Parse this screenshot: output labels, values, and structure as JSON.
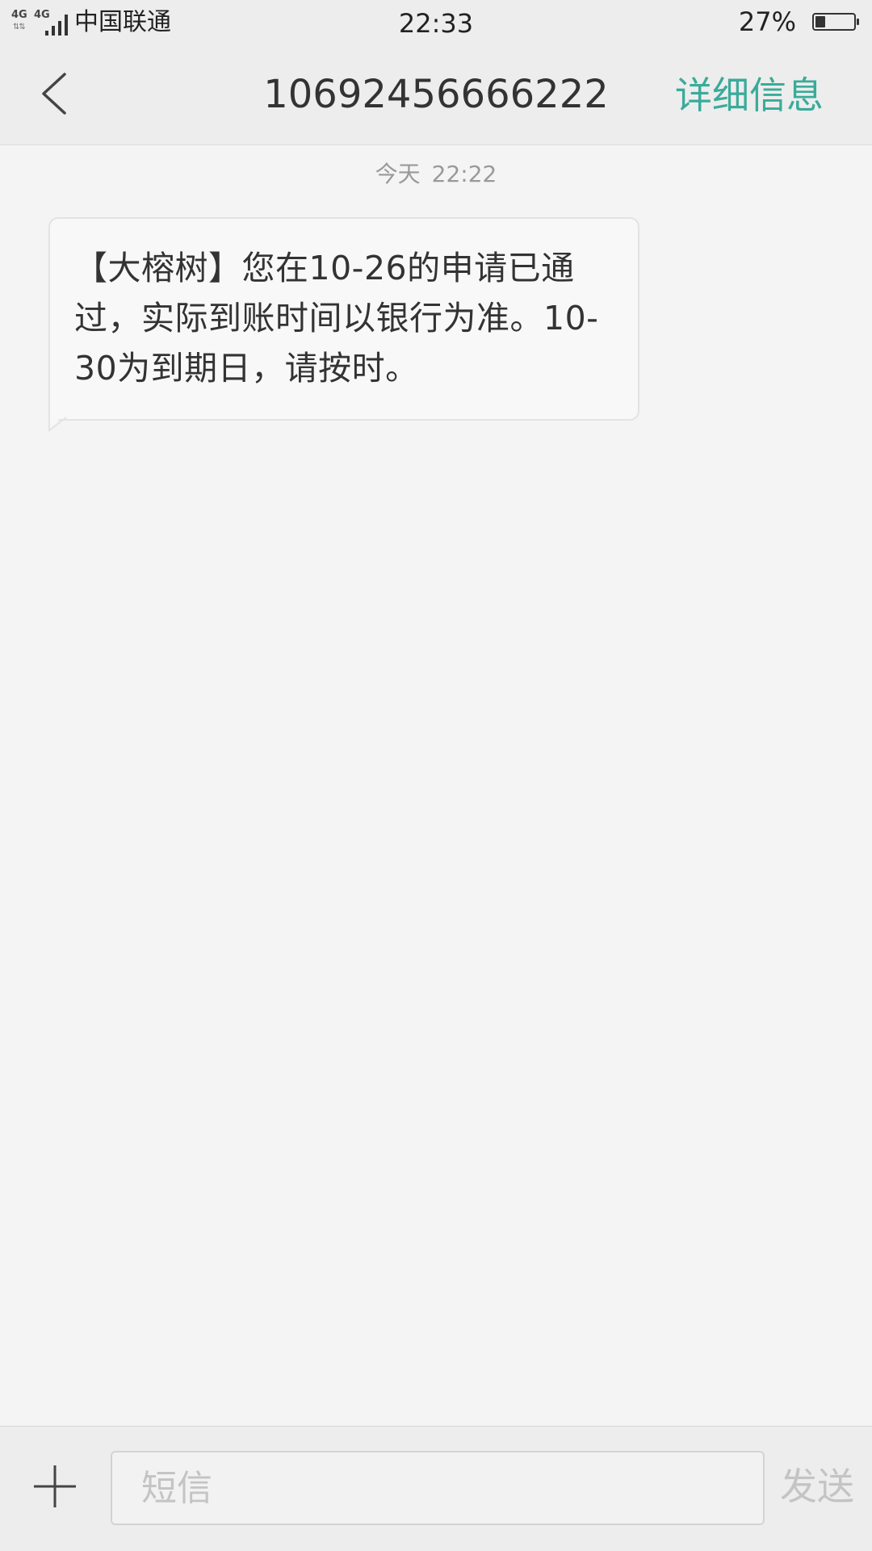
{
  "status_bar": {
    "network_1": "4G",
    "network_2": "4G",
    "carrier": "中国联通",
    "time": "22:33",
    "battery_percent": "27%",
    "battery_level": 0.27
  },
  "header": {
    "title": "10692456666222",
    "details_label": "详细信息",
    "accent_color": "#3aab9a"
  },
  "conversation": {
    "timestamp_day": "今天",
    "timestamp_time": "22:22",
    "messages": [
      {
        "text": "【大榕树】您在10-26的申请已通过，实际到账时间以银行为准。10-30为到期日，请按时。"
      }
    ]
  },
  "input_bar": {
    "placeholder": "短信",
    "send_label": "发送"
  },
  "icons": {
    "back": "chevron-left-icon",
    "add": "plus-icon",
    "signal": "signal-bars-icon",
    "battery": "battery-icon"
  }
}
